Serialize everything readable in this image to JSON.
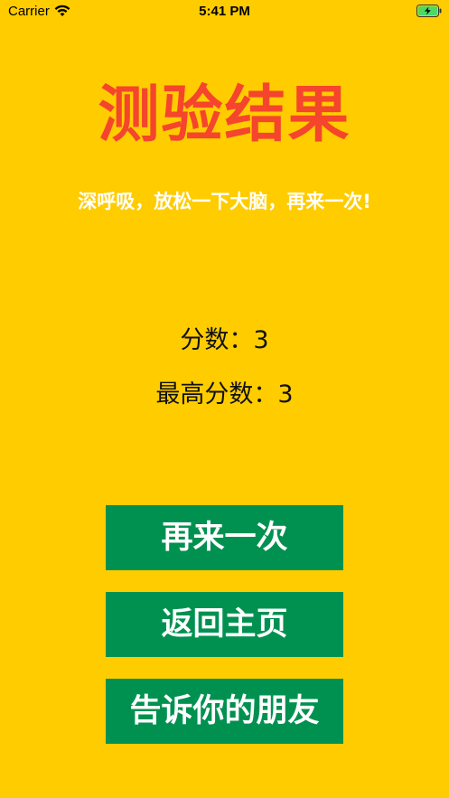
{
  "status_bar": {
    "carrier": "Carrier",
    "time": "5:41 PM",
    "wifi_icon": "wifi-icon",
    "battery_icon": "battery-charging-icon"
  },
  "result": {
    "title": "测验结果",
    "subtitle": "深呼吸，放松一下大脑，再来一次!",
    "score_text": "分数：3",
    "high_score_text": "最高分数：3"
  },
  "buttons": {
    "retry_label": "再来一次",
    "home_label": "返回主页",
    "share_label": "告诉你的朋友"
  },
  "colors": {
    "background": "#FFCC00",
    "title": "#F5452C",
    "subtitle": "#FFFFFF",
    "button_bg": "#009150",
    "button_text": "#FFFFFF"
  }
}
